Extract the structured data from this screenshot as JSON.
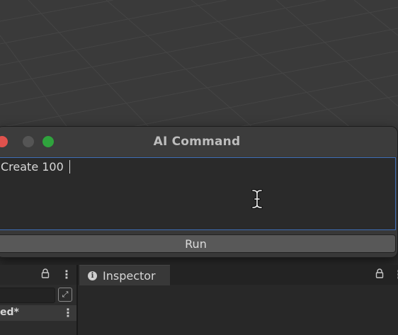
{
  "ai_command": {
    "title": "AI Command",
    "input_value": "Create 100 ",
    "run_label": "Run"
  },
  "hierarchy": {
    "row_label": "ed*",
    "lock_icon": "lock-icon",
    "menu_icon": "⋮"
  },
  "inspector": {
    "tab_label": "Inspector",
    "info_icon": "i",
    "lock_icon": "lock-icon",
    "menu_icon": "⋮"
  },
  "colors": {
    "close": "#e0524d",
    "minimize": "#555555",
    "maximize": "#2fa33d",
    "input_border": "#3f6fb7"
  }
}
